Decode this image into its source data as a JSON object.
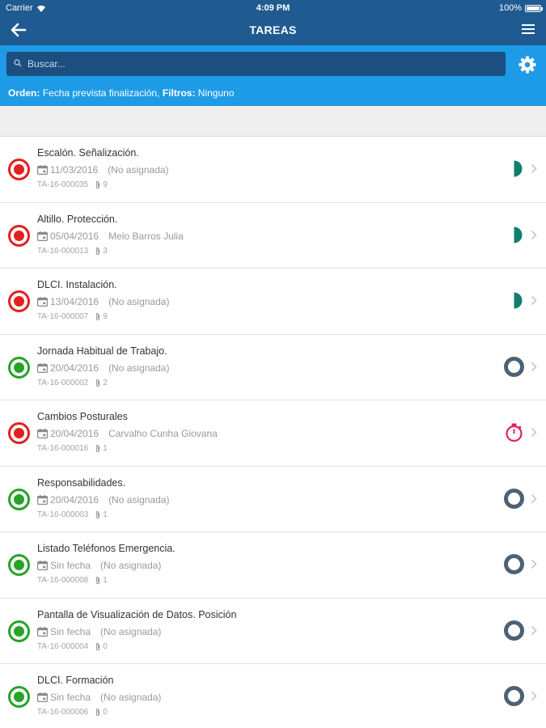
{
  "status_bar": {
    "carrier": "Carrier",
    "time": "4:09 PM",
    "battery": "100%"
  },
  "nav": {
    "title": "TAREAS"
  },
  "search": {
    "placeholder": "Buscar..."
  },
  "filters": {
    "order_label": "Orden:",
    "order_value": "Fecha prevista finalización,",
    "filters_label": "Filtros:",
    "filters_value": "Ninguno"
  },
  "colors": {
    "nav_bg": "#1f5b90",
    "search_area_bg": "#1e9be6",
    "status_red": "#e1211f",
    "status_green": "#27a328",
    "teal": "#117f6e",
    "pink": "#e0245a",
    "ring_gray": "#4c6274"
  },
  "tasks": [
    {
      "title": "Escalón. Señalización.",
      "date": "11/03/2016",
      "assignee": "(No asignada)",
      "code": "TA-16-000035",
      "attachments": "9",
      "status": "red",
      "indicator": "half-teal-icon"
    },
    {
      "title": "Altillo. Protección.",
      "date": "05/04/2016",
      "assignee": "Melo Barros Julia",
      "code": "TA-16-000013",
      "attachments": "3",
      "status": "red",
      "indicator": "half-teal-icon"
    },
    {
      "title": "DLCI. Instalación.",
      "date": "13/04/2016",
      "assignee": "(No asignada)",
      "code": "TA-16-000007",
      "attachments": "9",
      "status": "red",
      "indicator": "half-teal-icon"
    },
    {
      "title": "Jornada Habitual de Trabajo.",
      "date": "20/04/2016",
      "assignee": "(No asignada)",
      "code": "TA-16-000002",
      "attachments": "2",
      "status": "green",
      "indicator": "ring-icon"
    },
    {
      "title": "Cambios Posturales",
      "date": "20/04/2016",
      "assignee": "Carvalho Cunha Giovana",
      "code": "TA-16-000016",
      "attachments": "1",
      "status": "red",
      "indicator": "stopwatch-icon"
    },
    {
      "title": "Responsabilidades.",
      "date": "20/04/2016",
      "assignee": "(No asignada)",
      "code": "TA-16-000003",
      "attachments": "1",
      "status": "green",
      "indicator": "ring-icon"
    },
    {
      "title": "Listado Teléfonos Emergencia.",
      "date": "Sin fecha",
      "assignee": "(No asignada)",
      "code": "TA-16-000008",
      "attachments": "1",
      "status": "green",
      "indicator": "ring-icon"
    },
    {
      "title": "Pantalla de Visualización de Datos. Posición",
      "date": "Sin fecha",
      "assignee": "(No asignada)",
      "code": "TA-16-000004",
      "attachments": "0",
      "status": "green",
      "indicator": "ring-icon"
    },
    {
      "title": "DLCI. Formación",
      "date": "Sin fecha",
      "assignee": "(No asignada)",
      "code": "TA-16-000006",
      "attachments": "0",
      "status": "green",
      "indicator": "ring-icon"
    }
  ]
}
